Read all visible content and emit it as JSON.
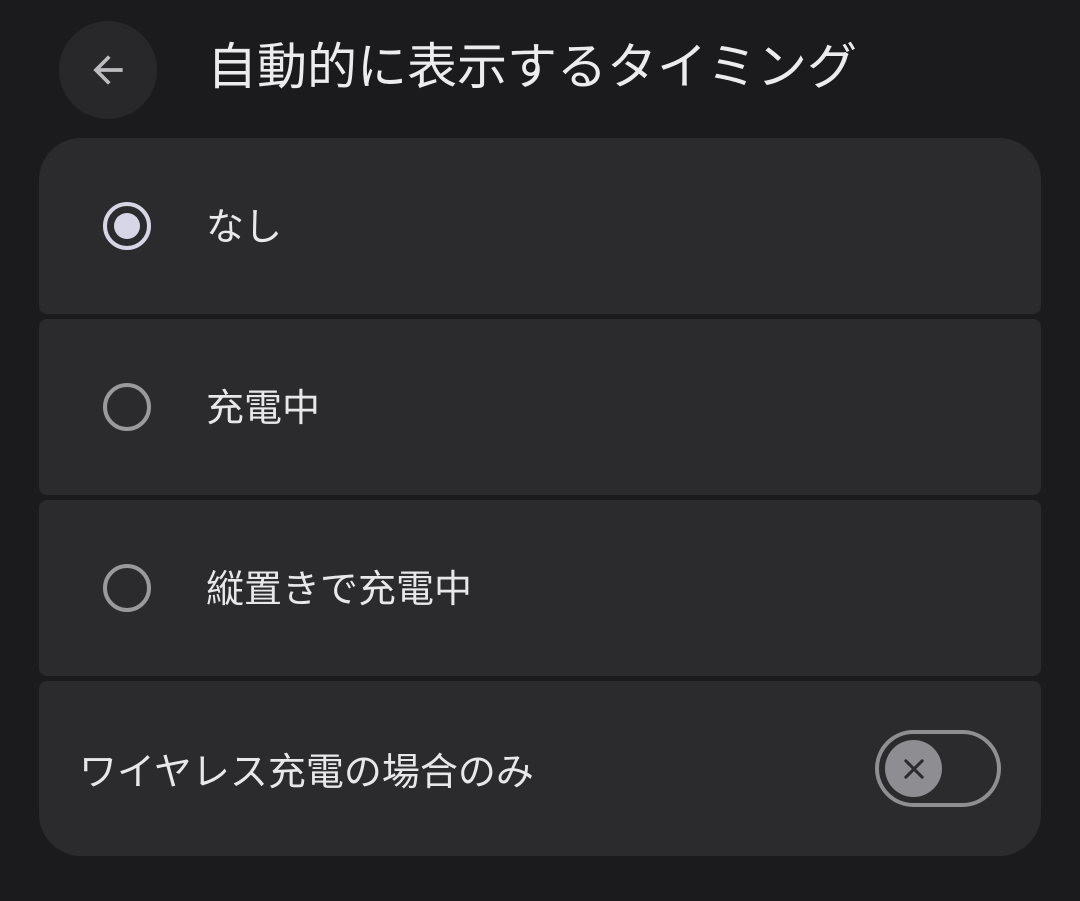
{
  "header": {
    "back_icon": "arrow-left-icon",
    "title": "自動的に表示するタイミング"
  },
  "options": [
    {
      "label": "なし",
      "selected": true
    },
    {
      "label": "充電中",
      "selected": false
    },
    {
      "label": "縦置きで充電中",
      "selected": false
    }
  ],
  "wireless_only": {
    "label": "ワイヤレス充電の場合のみ",
    "enabled": false,
    "thumb_icon": "close-icon"
  },
  "colors": {
    "background": "#1b1b1d",
    "card": "#2b2b2e",
    "radio_selected": "#d7d6e6",
    "radio_unselected": "#9a9a9e",
    "switch_thumb": "#8e8e92"
  }
}
